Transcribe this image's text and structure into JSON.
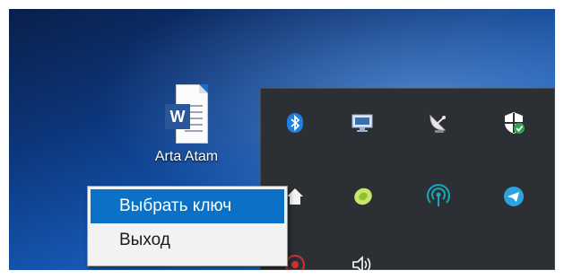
{
  "desktop": {
    "icon_label": "Arta Atam"
  },
  "tray": {
    "icons": [
      "bluetooth-icon",
      "display-settings-icon",
      "satellite-dish-icon",
      "windows-security-icon",
      "home-icon",
      "green-app-icon",
      "wireless-signal-icon",
      "telegram-icon",
      "red-app-icon",
      "volume-icon"
    ]
  },
  "context_menu": {
    "items": [
      {
        "label": "Выбрать ключ",
        "highlighted": true
      },
      {
        "label": "Выход",
        "highlighted": false
      }
    ]
  },
  "colors": {
    "highlight": "#0a71c7",
    "tray_background": "#2c2f34",
    "word_blue": "#2b579a"
  }
}
